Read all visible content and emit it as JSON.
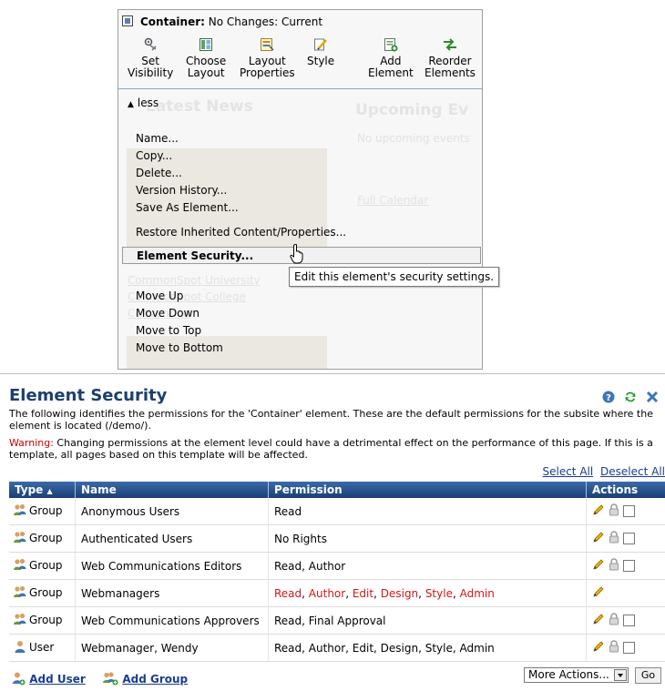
{
  "menu": {
    "title_bold": "Container:",
    "title_rest": "No Changes: Current",
    "toolbar": [
      {
        "id": "set-visibility",
        "label_line1": "Set",
        "label_line2": "Visibility",
        "icon": "visibility-icon"
      },
      {
        "id": "choose-layout",
        "label_line1": "Choose",
        "label_line2": "Layout",
        "icon": "layout-icon"
      },
      {
        "id": "layout-properties",
        "label_line1": "Layout",
        "label_line2": "Properties",
        "icon": "properties-icon"
      },
      {
        "id": "style",
        "label_line1": "Style",
        "label_line2": "",
        "icon": "style-icon"
      },
      {
        "id": "add-element",
        "label_line1": "Add",
        "label_line2": "Element",
        "icon": "add-element-icon"
      },
      {
        "id": "reorder-elements",
        "label_line1": "Reorder",
        "label_line2": "Elements",
        "icon": "reorder-icon"
      }
    ],
    "less_label": "less",
    "items_group1": [
      "Name...",
      "Copy...",
      "Delete...",
      "Version History...",
      "Save As Element..."
    ],
    "restore_label": "Restore Inherited Content/Properties...",
    "security_label": "Element Security...",
    "tooltip": "Edit this element's security settings.",
    "items_group2": [
      "Move Up",
      "Move Down",
      "Move to Top",
      "Move to Bottom"
    ]
  },
  "panel": {
    "title": "Element Security",
    "description": "The following identifies the permissions for the 'Container' element. These are the default permissions for the subsite where the element is located (/demo/).",
    "warning_label": "Warning:",
    "warning_text": " Changing permissions at the element level could have a detrimental effect on the performance of this page. If this is a template, all pages based on this template will be affected.",
    "select_all": "Select All",
    "deselect_all": "Deselect All",
    "columns": {
      "type": "Type",
      "name": "Name",
      "permission": "Permission",
      "actions": "Actions"
    },
    "rows": [
      {
        "type": "Group",
        "name": "Anonymous Users",
        "permission": "Read",
        "red": false,
        "checkbox": true
      },
      {
        "type": "Group",
        "name": "Authenticated Users",
        "permission": "No Rights",
        "red": false,
        "checkbox": true
      },
      {
        "type": "Group",
        "name": "Web Communications Editors",
        "permission": "Read, Author",
        "red": false,
        "checkbox": true
      },
      {
        "type": "Group",
        "name": "Webmanagers",
        "permission": "Read, Author, Edit, Design, Style, Admin",
        "red": true,
        "checkbox": false
      },
      {
        "type": "Group",
        "name": "Web Communications Approvers",
        "permission": "Read, Final Approval",
        "red": false,
        "checkbox": true
      },
      {
        "type": "User",
        "name": "Webmanager, Wendy",
        "permission": "Read, Author, Edit, Design, Style, Admin",
        "red": false,
        "checkbox": true
      }
    ],
    "add_user": "Add User",
    "add_group": "Add Group",
    "more_actions": "More Actions...",
    "go": "Go"
  },
  "colors": {
    "header": "#1f4a86",
    "warning": "#cc0000",
    "link": "#1a3d8f"
  }
}
